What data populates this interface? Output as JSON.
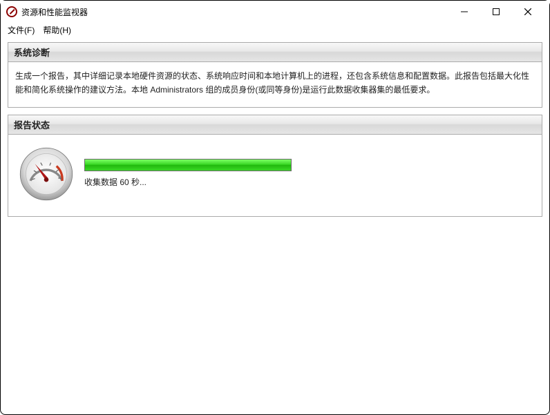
{
  "window": {
    "title": "资源和性能监视器"
  },
  "menu": {
    "file": "文件(F)",
    "help": "帮助(H)"
  },
  "panels": {
    "diagnostics": {
      "title": "系统诊断",
      "body": "生成一个报告，其中详细记录本地硬件资源的状态、系统响应时间和本地计算机上的进程，还包含系统信息和配置数据。此报告包括最大化性能和简化系统操作的建议方法。本地 Administrators 组的成员身份(或同等身份)是运行此数据收集器集的最低要求。"
    },
    "status": {
      "title": "报告状态",
      "progress_percent": 100,
      "message": "收集数据 60 秒..."
    }
  }
}
